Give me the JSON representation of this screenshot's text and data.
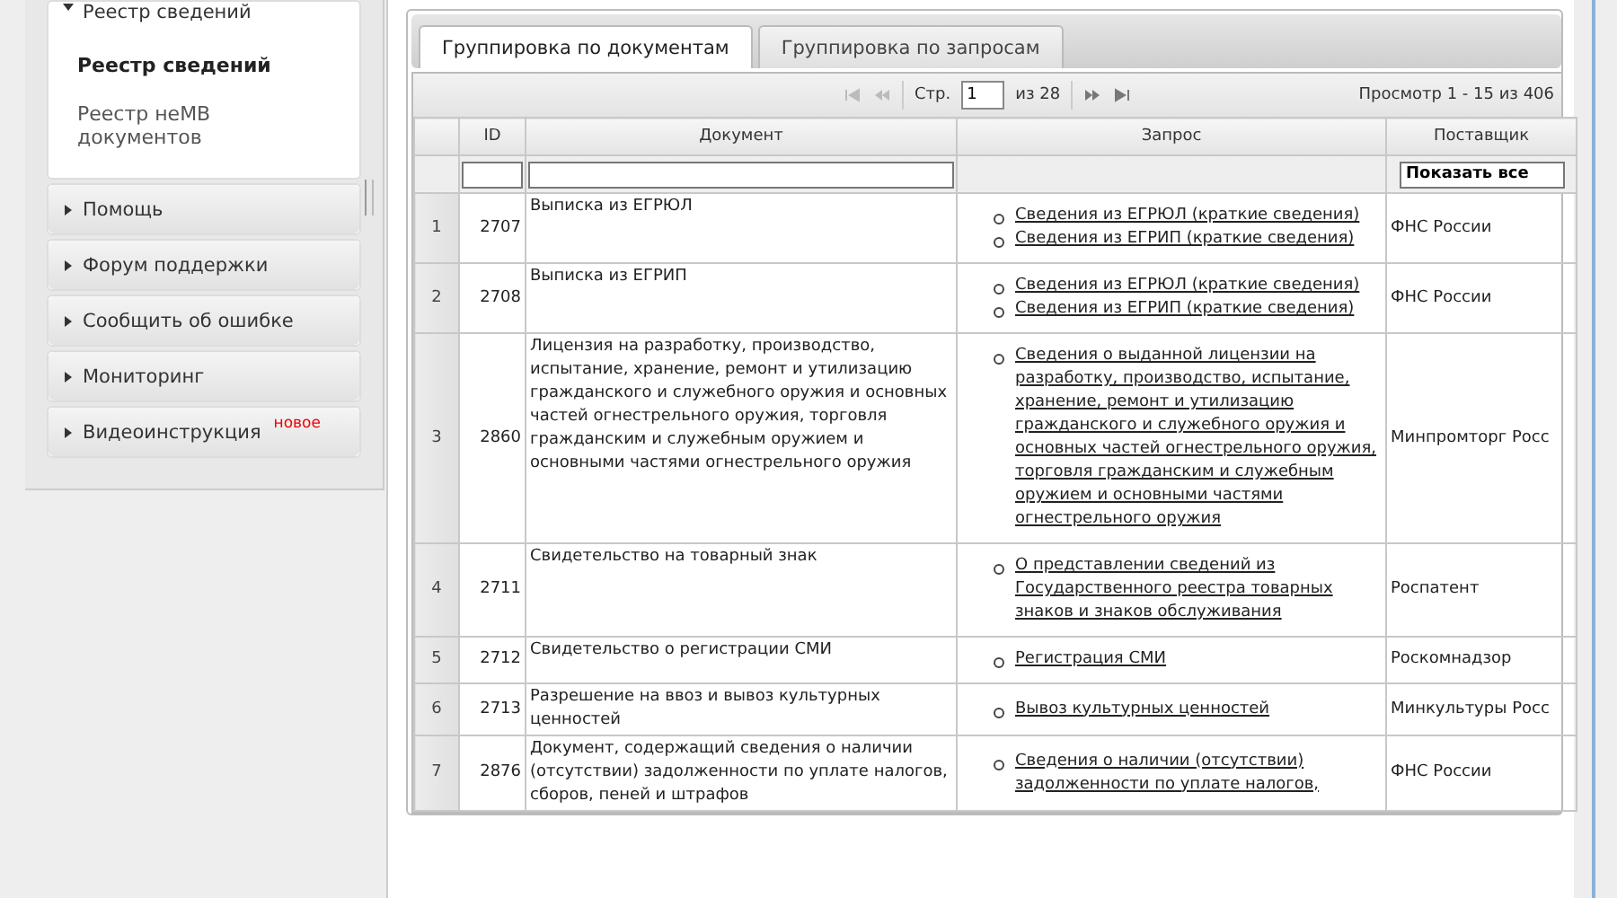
{
  "sidebar": {
    "sections": [
      {
        "title": "Реестр сведений",
        "expanded": true,
        "items": [
          {
            "label": "Реестр сведений",
            "selected": true
          },
          {
            "label": "Реестр неМВ документов",
            "selected": false
          }
        ]
      },
      {
        "title": "Помощь",
        "expanded": false
      },
      {
        "title": "Форум поддержки",
        "expanded": false
      },
      {
        "title": "Сообщить об ошибке",
        "expanded": false
      },
      {
        "title": "Мониторинг",
        "expanded": false
      },
      {
        "title": "Видеоинструкция",
        "expanded": false,
        "badge": "новое"
      }
    ]
  },
  "tabs": [
    {
      "label": "Группировка по документам",
      "selected": true
    },
    {
      "label": "Группировка по запросам",
      "selected": false
    }
  ],
  "pager": {
    "page_label": "Стр.",
    "page": "1",
    "total": "из 28",
    "summary": "Просмотр 1 - 15 из 406"
  },
  "table": {
    "columns": [
      "ID",
      "Документ",
      "Запрос",
      "Поставщик"
    ],
    "supplier_filter": "Показать все",
    "rows": [
      {
        "n": "1",
        "id": "2707",
        "document": "Выписка из ЕГРЮЛ",
        "requests": [
          "Сведения из ЕГРЮЛ (краткие сведения)",
          "Сведения из ЕГРИП (краткие сведения)"
        ],
        "supplier": "ФНС России"
      },
      {
        "n": "2",
        "id": "2708",
        "document": "Выписка из ЕГРИП",
        "requests": [
          "Сведения из ЕГРЮЛ (краткие сведения)",
          "Сведения из ЕГРИП (краткие сведения)"
        ],
        "supplier": "ФНС России"
      },
      {
        "n": "3",
        "id": "2860",
        "document": "Лицензия на разработку, производство, испытание, хранение, ремонт и утилизацию гражданского и служебного оружия и основных частей огнестрельного оружия, торговля гражданским и служебным оружием и основными частями огнестрельного оружия",
        "requests": [
          "Сведения о выданной лицензии на разработку, производство, испытание, хранение, ремонт и утилизацию гражданского и служебного оружия и основных частей огнестрельного оружия, торговля гражданским и служебным оружием и основными частями огнестрельного оружия"
        ],
        "supplier": "Минпромторг Росс"
      },
      {
        "n": "4",
        "id": "2711",
        "document": "Свидетельство на товарный знак",
        "requests": [
          "О представлении сведений из Государственного реестра товарных знаков и знаков обслуживания"
        ],
        "supplier": "Роспатент"
      },
      {
        "n": "5",
        "id": "2712",
        "document": "Свидетельство о регистрации СМИ",
        "requests": [
          "Регистрация СМИ"
        ],
        "supplier": "Роскомнадзор"
      },
      {
        "n": "6",
        "id": "2713",
        "document": "Разрешение на ввоз и вывоз культурных ценностей",
        "requests": [
          "Вывоз культурных ценностей"
        ],
        "supplier": "Минкультуры Росс"
      },
      {
        "n": "7",
        "id": "2876",
        "document": "Документ, содержащий сведения о наличии (отсутствии) задолженности по уплате налогов, сборов, пеней и штрафов",
        "requests": [
          "Сведения о наличии (отсутствии) задолженности по уплате налогов,"
        ],
        "supplier": "ФНС России"
      }
    ]
  }
}
